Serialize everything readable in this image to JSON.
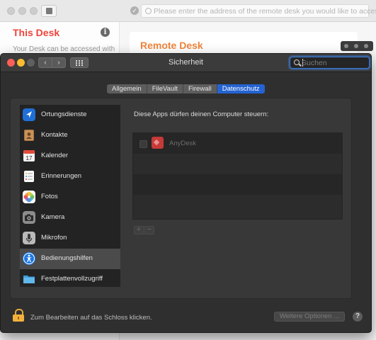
{
  "background_app": {
    "address_placeholder": "Please enter the address of the remote desk you would like to access.",
    "this_desk_title": "This Desk",
    "this_desk_subtitle": "Your Desk can be accessed with",
    "remote_desk_title": "Remote Desk",
    "accent_red": "#ef443b",
    "accent_orange": "#f0843c"
  },
  "window": {
    "title": "Sicherheit",
    "search_placeholder": "Suchen"
  },
  "tabs": [
    {
      "label": "Allgemein",
      "active": false
    },
    {
      "label": "FileVault",
      "active": false
    },
    {
      "label": "Firewall",
      "active": false
    },
    {
      "label": "Datenschutz",
      "active": true
    }
  ],
  "categories": [
    {
      "label": "Ortungsdienste",
      "icon": "location-arrow-icon",
      "color": "#1f6fd6"
    },
    {
      "label": "Kontakte",
      "icon": "contacts-book-icon",
      "color": "#a8743f"
    },
    {
      "label": "Kalender",
      "icon": "calendar-icon",
      "color": "#f3f3f3",
      "day": "17"
    },
    {
      "label": "Erinnerungen",
      "icon": "reminders-list-icon",
      "color": "#fafafa"
    },
    {
      "label": "Fotos",
      "icon": "photos-flower-icon",
      "color": "#ffffff"
    },
    {
      "label": "Kamera",
      "icon": "camera-icon",
      "color": "#8c8c8c"
    },
    {
      "label": "Mikrofon",
      "icon": "microphone-icon",
      "color": "#b9b9b9"
    },
    {
      "label": "Bedienungshilfen",
      "icon": "accessibility-icon",
      "color": "#1e78e0",
      "selected": true
    },
    {
      "label": "Festplattenvollzugriff",
      "icon": "folder-icon",
      "color": "#5ab2e8"
    }
  ],
  "apps_panel": {
    "title": "Diese Apps dürfen deinen Computer steuern:",
    "apps": [
      {
        "name": "AnyDesk",
        "checked": false,
        "icon": "anydesk-icon",
        "color": "#c63a37"
      }
    ],
    "add_label": "+",
    "remove_label": "−"
  },
  "footer": {
    "lock_text": "Zum Bearbeiten auf das Schloss klicken.",
    "more_options_label": "Weitere Optionen ...",
    "help_label": "?"
  }
}
